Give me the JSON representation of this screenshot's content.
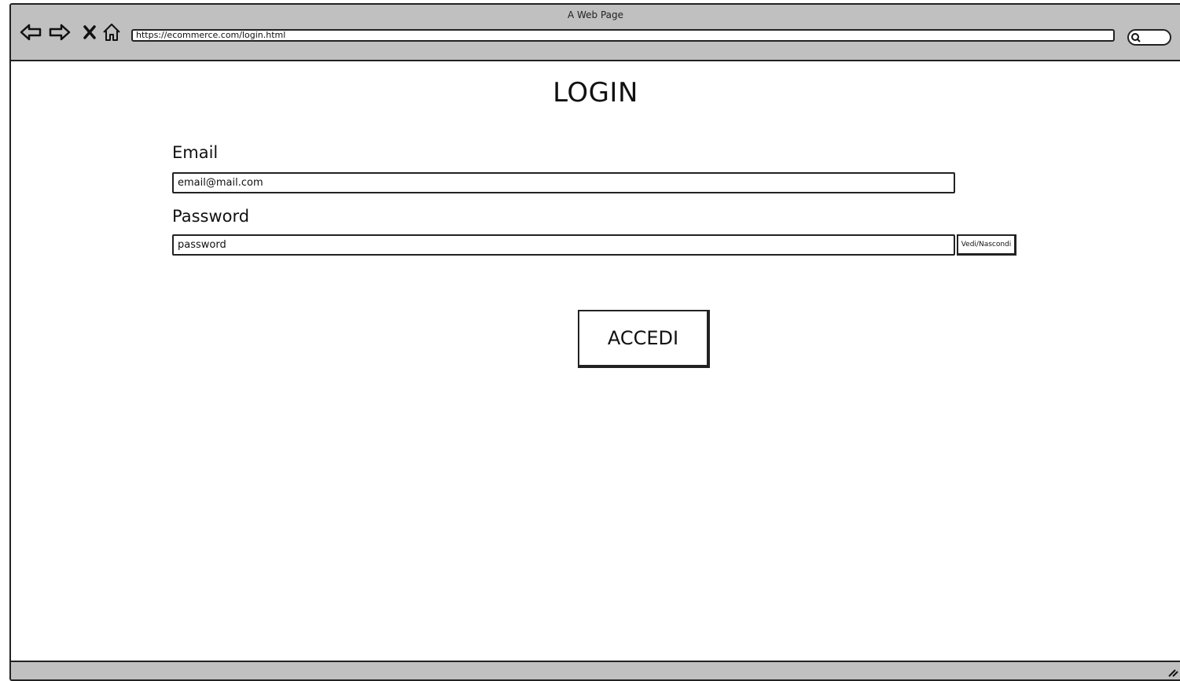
{
  "browser": {
    "window_title": "A Web Page",
    "url": "https://ecommerce.com/login.html",
    "icons": [
      "back-arrow-icon",
      "forward-arrow-icon",
      "close-icon",
      "home-icon",
      "search-icon",
      "resize-grip-icon"
    ]
  },
  "page": {
    "title": "LOGIN",
    "email": {
      "label": "Email",
      "value": "email@mail.com"
    },
    "password": {
      "label": "Password",
      "value": "password",
      "toggle_label": "Vedi/Nascondi"
    },
    "submit_label": "ACCEDI"
  }
}
